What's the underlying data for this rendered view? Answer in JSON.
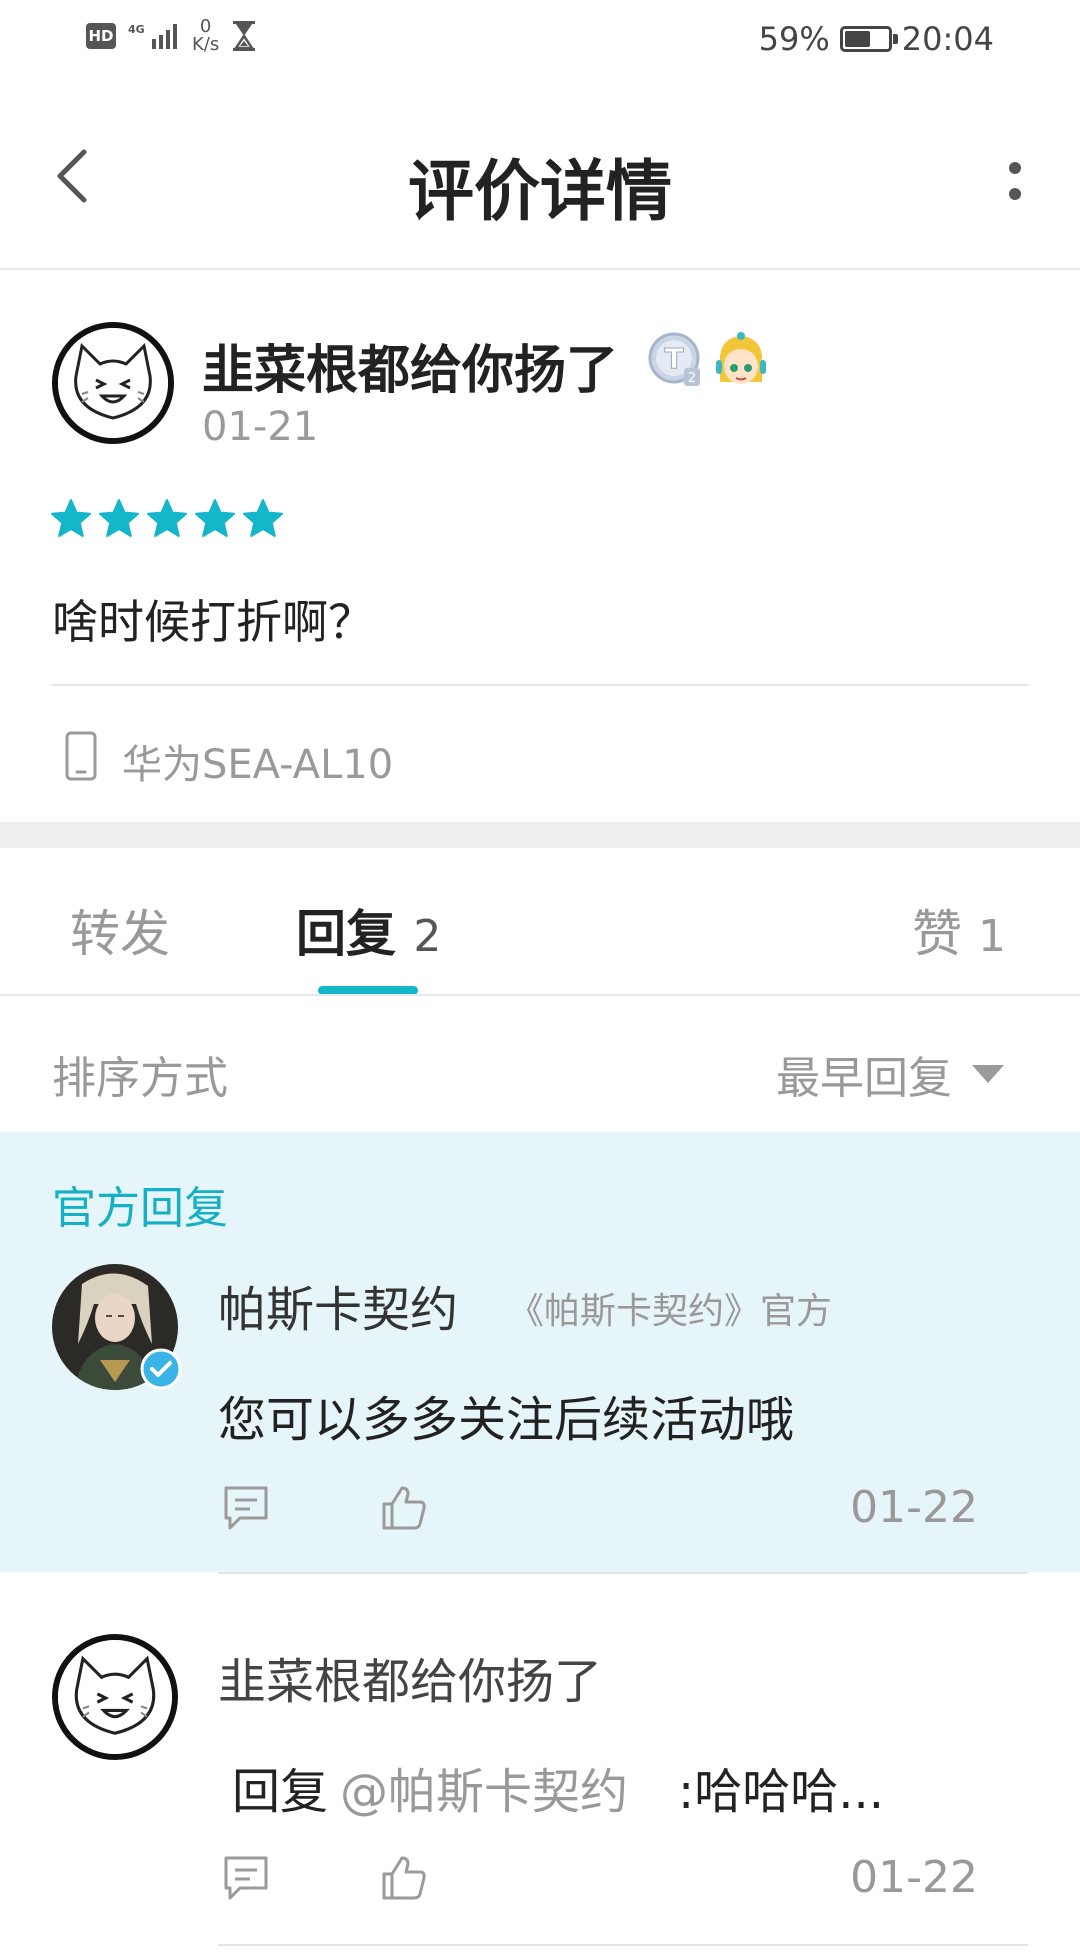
{
  "status_bar": {
    "hd": "HD",
    "network": "4G",
    "speed_value": "0",
    "speed_unit": "K/s",
    "battery_percent": "59%",
    "battery_level": 0.59,
    "time": "20:04"
  },
  "header": {
    "title": "评价详情",
    "back_icon": "chevron-left-icon",
    "more_icon": "more-vertical-icon"
  },
  "review": {
    "username": "韭菜根都给你扬了",
    "date": "01-21",
    "rating": 5,
    "text": "啥时候打折啊？",
    "device": "华为SEA-AL10",
    "star_color": "#14b6c9"
  },
  "tabs": {
    "forward": "转发",
    "reply": "回复",
    "reply_count": "2",
    "like": "赞",
    "like_count": "1",
    "accent": "#14b6c9"
  },
  "sort": {
    "label": "排序方式",
    "value": "最早回复"
  },
  "official_reply": {
    "section_label": "官方回复",
    "name": "帕斯卡契约",
    "tag": "《帕斯卡契约》官方",
    "text": "您可以多多关注后续活动哦",
    "date": "01-22",
    "background": "#e6f5fa"
  },
  "user_reply": {
    "name": "韭菜根都给你扬了",
    "prefix": "回复",
    "mention": "@帕斯卡契约",
    "body": ":哈哈哈...",
    "date": "01-22"
  }
}
